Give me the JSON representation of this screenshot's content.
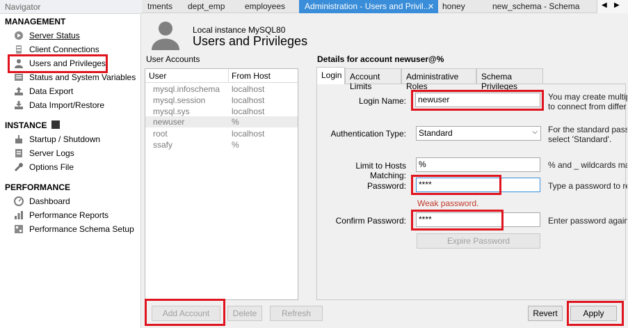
{
  "navigator": {
    "title": "Navigator",
    "management_label": "MANAGEMENT",
    "management_items": [
      {
        "label": "Server Status",
        "icon": "play-icon"
      },
      {
        "label": "Client Connections",
        "icon": "client-connections-icon"
      },
      {
        "label": "Users and Privileges",
        "icon": "user-icon"
      },
      {
        "label": "Status and System Variables",
        "icon": "variables-icon"
      },
      {
        "label": "Data Export",
        "icon": "upload-icon"
      },
      {
        "label": "Data Import/Restore",
        "icon": "download-icon"
      }
    ],
    "instance_label": "INSTANCE",
    "instance_items": [
      {
        "label": "Startup / Shutdown",
        "icon": "power-icon"
      },
      {
        "label": "Server Logs",
        "icon": "logs-icon"
      },
      {
        "label": "Options File",
        "icon": "wrench-icon"
      }
    ],
    "performance_label": "PERFORMANCE",
    "performance_items": [
      {
        "label": "Dashboard",
        "icon": "dashboard-icon"
      },
      {
        "label": "Performance Reports",
        "icon": "reports-icon"
      },
      {
        "label": "Performance Schema Setup",
        "icon": "schema-setup-icon"
      }
    ]
  },
  "tabs": [
    {
      "label": "tments"
    },
    {
      "label": "dept_emp"
    },
    {
      "label": "employees"
    },
    {
      "label": "Administration - Users and Privil..."
    },
    {
      "label": "honey"
    },
    {
      "label": "new_schema - Schema"
    }
  ],
  "header": {
    "instance": "Local instance MySQL80",
    "title": "Users and Privileges"
  },
  "accounts": {
    "section_label": "User Accounts",
    "col_user": "User",
    "col_host": "From Host",
    "rows": [
      {
        "user": "mysql.infoschema",
        "host": "localhost"
      },
      {
        "user": "mysql.session",
        "host": "localhost"
      },
      {
        "user": "mysql.sys",
        "host": "localhost"
      },
      {
        "user": "newuser",
        "host": "%"
      },
      {
        "user": "root",
        "host": "localhost"
      },
      {
        "user": "ssafy",
        "host": "%"
      }
    ]
  },
  "details": {
    "title": "Details for account newuser@%",
    "tabs": [
      "Login",
      "Account Limits",
      "Administrative Roles",
      "Schema Privileges"
    ],
    "login_name_label": "Login Name:",
    "login_name_value": "newuser",
    "login_name_hint": "You may create multip\nto connect from differ",
    "auth_type_label": "Authentication Type:",
    "auth_type_value": "Standard",
    "auth_type_hint": "For the standard pass\nselect 'Standard'.",
    "limit_hosts_label": "Limit to Hosts Matching:",
    "limit_hosts_value": "%",
    "limit_hosts_hint": "% and _ wildcards ma",
    "password_label": "Password:",
    "password_value": "****",
    "password_hint": "Type a password to re",
    "weak_password": "Weak password.",
    "confirm_label": "Confirm Password:",
    "confirm_value": "****",
    "confirm_hint": "Enter password again",
    "expire_button": "Expire Password"
  },
  "buttons": {
    "add_account": "Add Account",
    "delete": "Delete",
    "refresh": "Refresh",
    "revert": "Revert",
    "apply": "Apply"
  },
  "colors": {
    "highlight": "#e0141e",
    "active_tab": "#3a8dd8",
    "weak_text": "#c0392b"
  }
}
